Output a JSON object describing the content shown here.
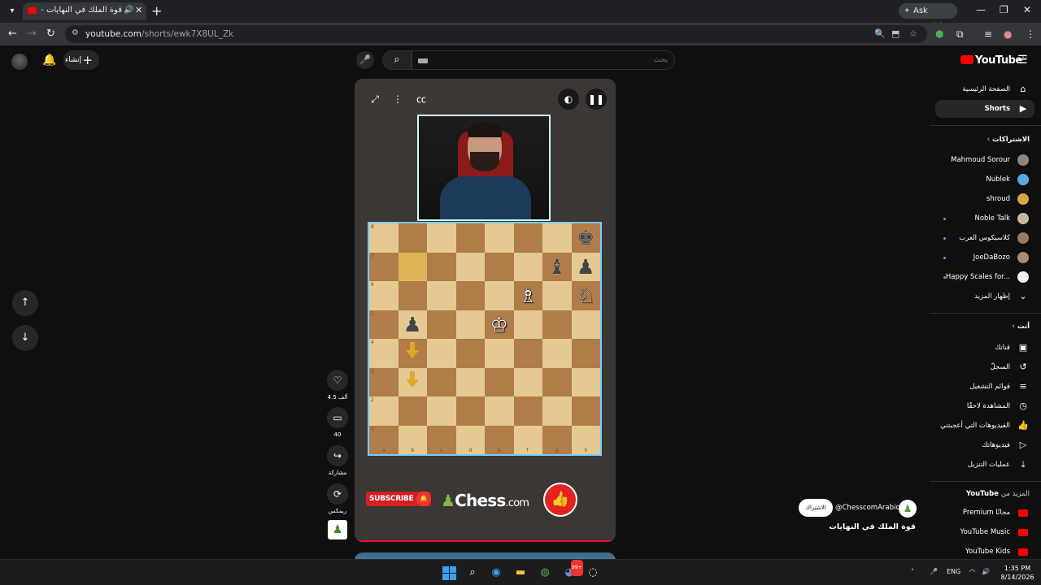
{
  "browser": {
    "tab_title": "قوة الملك في النهايات - YouTube",
    "tab_visible_title": "قوة الملك في النهايات - ube",
    "url_host": "youtube.com",
    "url_path": "/shorts/ewk7X8UL_Zk",
    "ask_gemini": "Ask Gemini"
  },
  "header": {
    "create_label": "إنشاء",
    "search_placeholder": "بحث",
    "logo_text": "YouTube",
    "logo_country": "JO"
  },
  "sidebar": {
    "main": [
      {
        "label": "الصفحة الرئيسية",
        "icon": "home-icon"
      },
      {
        "label": "Shorts",
        "icon": "shorts-icon",
        "active": true
      }
    ],
    "subscriptions_heading": "الاشتراكات",
    "subscriptions": [
      {
        "label": "Mahmoud Sorour",
        "avatar_color": "#888888",
        "dot": false
      },
      {
        "label": "Nublek",
        "avatar_color": "#5aa8e0",
        "dot": false
      },
      {
        "label": "shroud",
        "avatar_color": "#d9a441",
        "dot": false
      },
      {
        "label": "Noble Talk",
        "avatar_color": "#c7b8a0",
        "dot": true
      },
      {
        "label": "كلاسيكوس العرب",
        "avatar_color": "#9a7a5a",
        "dot": true
      },
      {
        "label": "JoeDaBozo",
        "avatar_color": "#b08870",
        "dot": true
      },
      {
        "label": "Happy Scales for...",
        "avatar_color": "#f0f0f0",
        "dot": true
      }
    ],
    "show_more": "إظهار المزيد",
    "you_heading": "أنت",
    "you_items": [
      {
        "label": "قناتك",
        "icon": "channel-icon"
      },
      {
        "label": "السجلّ",
        "icon": "history-icon"
      },
      {
        "label": "قوائم التشغيل",
        "icon": "playlists-icon"
      },
      {
        "label": "المشاهدة لاحقًا",
        "icon": "watch-later-icon"
      },
      {
        "label": "الفيديوهات التي أعجبتني",
        "icon": "liked-icon"
      },
      {
        "label": "فيديوهاتك",
        "icon": "your-videos-icon"
      },
      {
        "label": "عمليات التنزيل",
        "icon": "downloads-icon"
      }
    ],
    "more_heading_prefix": "المزيد من",
    "more_heading_brand": "YouTube",
    "more_items": [
      {
        "label": "Premium مجانًا",
        "icon": "yt-premium-icon"
      },
      {
        "label": "YouTube Music",
        "icon": "yt-music-icon"
      },
      {
        "label": "YouTube Kids",
        "icon": "yt-kids-icon"
      }
    ]
  },
  "player": {
    "board_files": [
      "a",
      "b",
      "c",
      "d",
      "e",
      "f",
      "g",
      "h"
    ],
    "board_ranks": [
      "8",
      "7",
      "6",
      "5",
      "4",
      "3",
      "2",
      "1"
    ],
    "pieces": {
      "h8": {
        "glyph": "♚",
        "color": "b"
      },
      "g7": {
        "glyph": "♝",
        "color": "b"
      },
      "h7": {
        "glyph": "♟",
        "color": "b"
      },
      "f6": {
        "glyph": "♗",
        "color": "w"
      },
      "h6": {
        "glyph": "♘",
        "color": "w"
      },
      "b5": {
        "glyph": "♟",
        "color": "b"
      },
      "e5": {
        "glyph": "♔",
        "color": "w"
      }
    },
    "highlighted_squares": [
      "b7"
    ],
    "subscribe_label": "SUBSCRIBE",
    "chess_logo": "Chess",
    "chess_logo_suffix": ".com"
  },
  "actions": {
    "likes": "4.5 ألف",
    "comments": "40",
    "share": "مشاركة",
    "remix": "ريمكس"
  },
  "channel": {
    "handle": "@ChesscomArabic",
    "subscribe": "الاشتراك",
    "title": "قوة الملك في النهايات"
  },
  "taskbar": {
    "lang": "ENG",
    "time": "1:35 PM",
    "date": "8/14/2026",
    "badge": "99+"
  }
}
